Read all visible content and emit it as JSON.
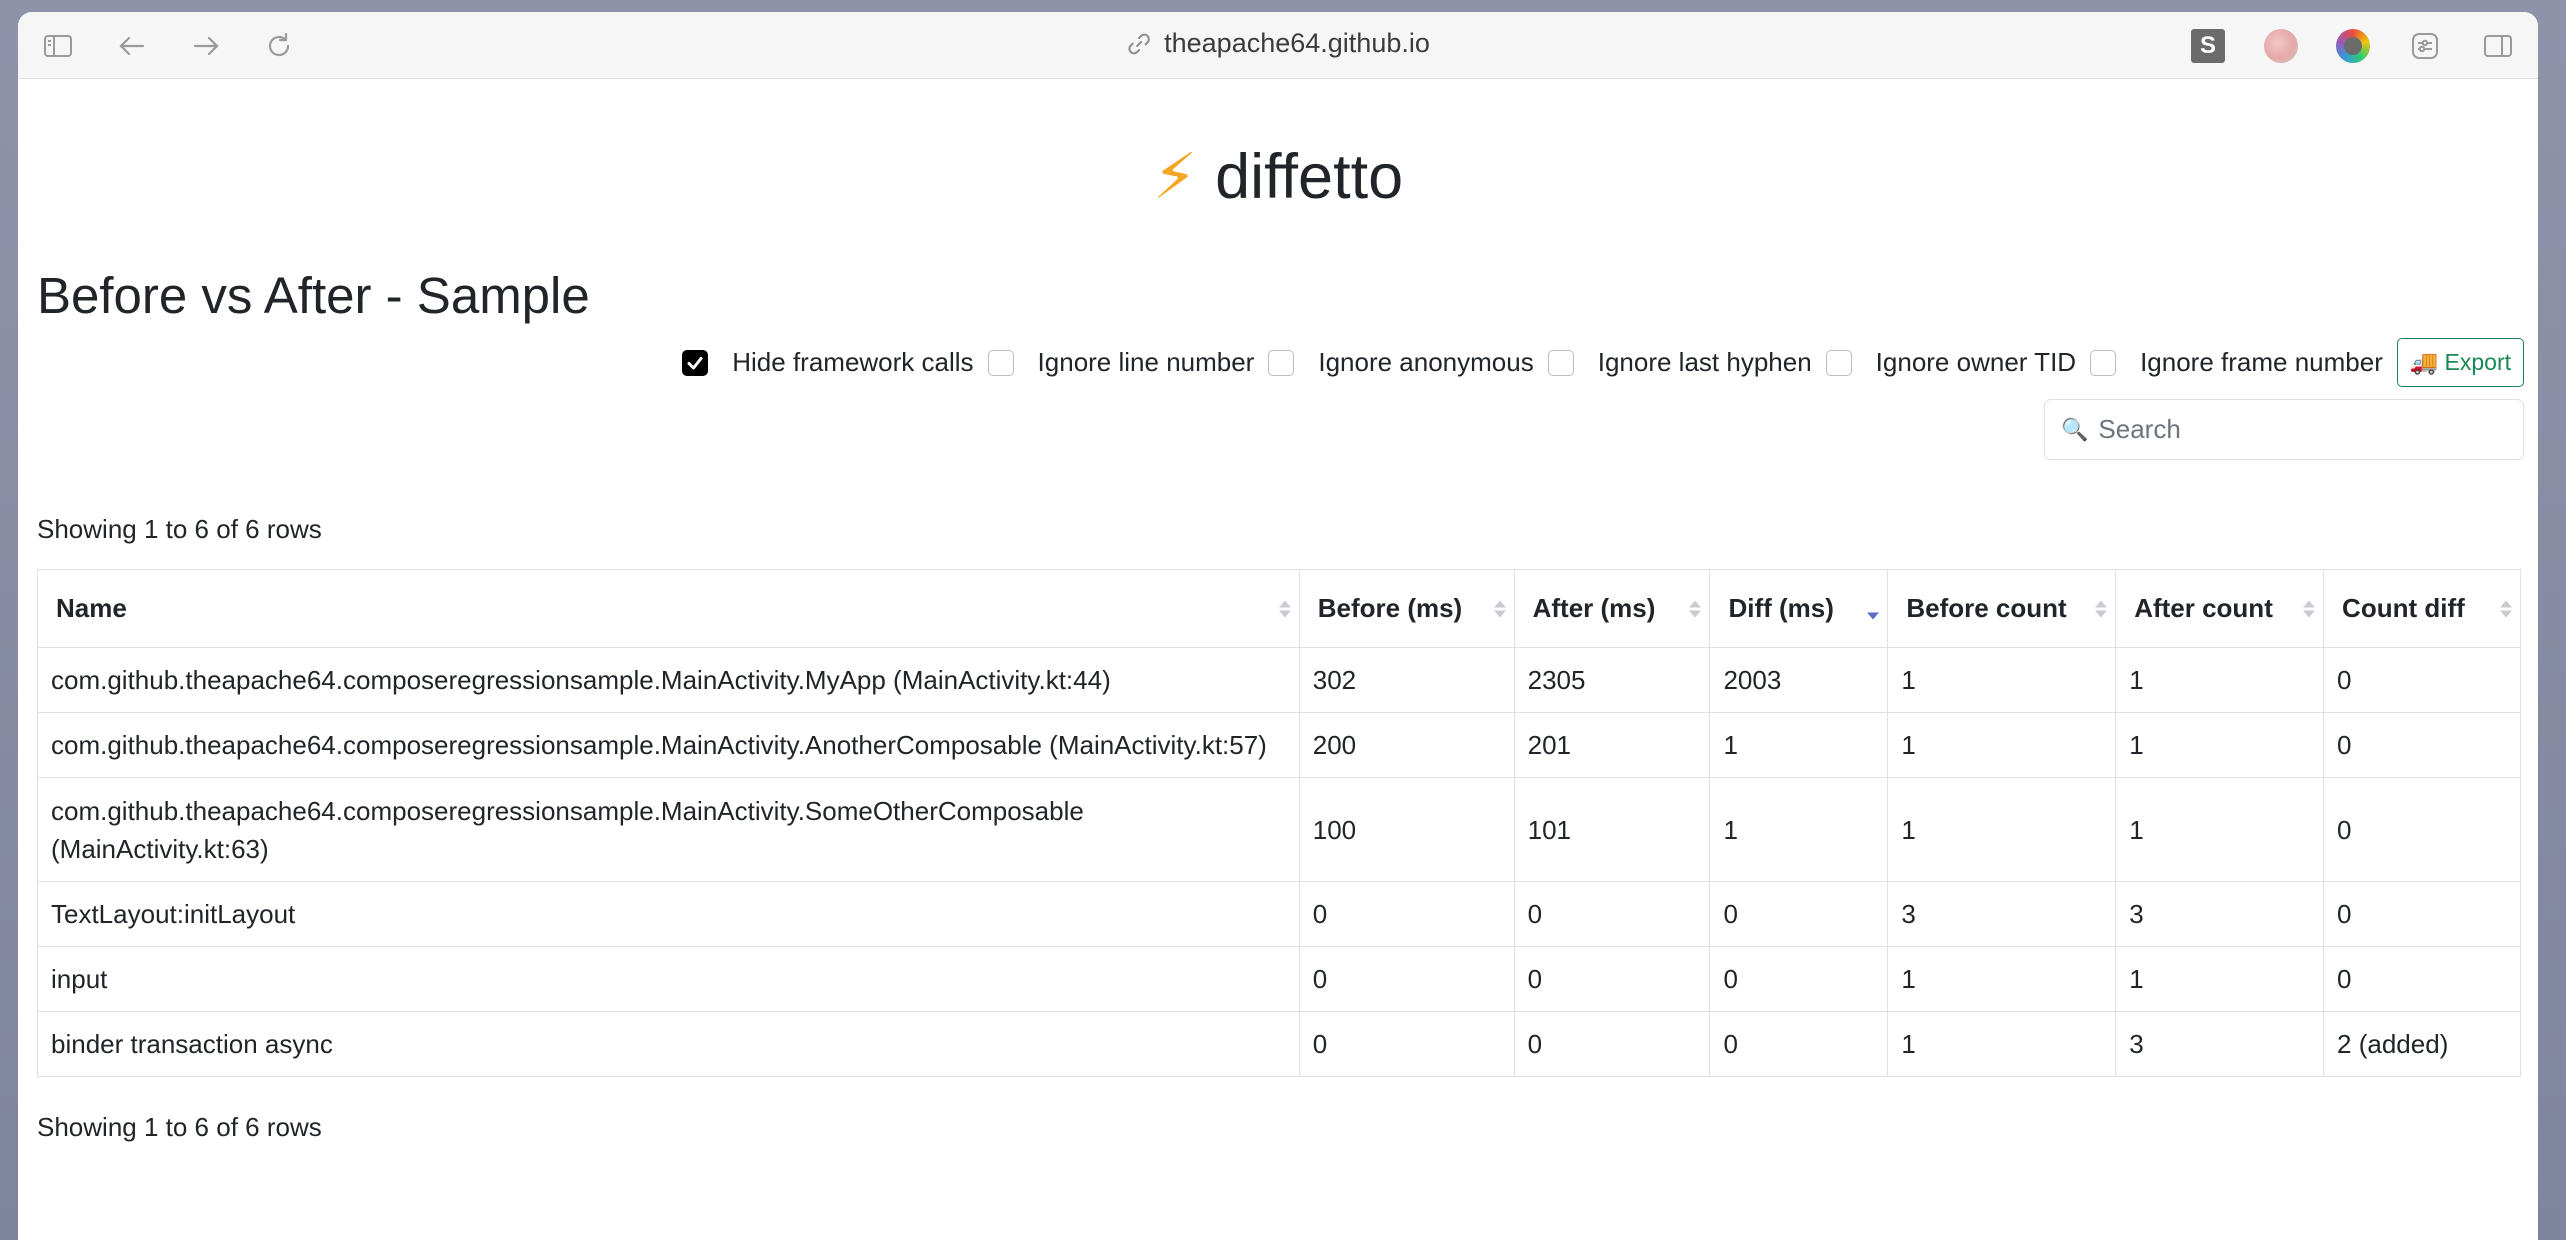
{
  "browser": {
    "url": "theapache64.github.io"
  },
  "brand": {
    "bolt": "⚡",
    "name": "diffetto"
  },
  "page_title": "Before vs After - Sample",
  "options": [
    {
      "label": "Hide framework calls",
      "checked": true
    },
    {
      "label": "Ignore line number",
      "checked": false
    },
    {
      "label": "Ignore anonymous",
      "checked": false
    },
    {
      "label": "Ignore last hyphen",
      "checked": false
    },
    {
      "label": "Ignore owner TID",
      "checked": false
    },
    {
      "label": "Ignore frame number",
      "checked": false
    }
  ],
  "export": {
    "emoji": "🚚",
    "label": "Export"
  },
  "search": {
    "placeholder": "Search"
  },
  "pagination": {
    "top": "Showing 1 to 6 of 6 rows",
    "bottom": "Showing 1 to 6 of 6 rows"
  },
  "table": {
    "columns": [
      "Name",
      "Before (ms)",
      "After (ms)",
      "Diff (ms)",
      "Before count",
      "After count",
      "Count diff"
    ],
    "sorted_column": "Diff (ms)",
    "sort_direction": "desc",
    "rows": [
      [
        "com.github.theapache64.composeregressionsample.MainActivity.MyApp (MainActivity.kt:44)",
        "302",
        "2305",
        "2003",
        "1",
        "1",
        "0"
      ],
      [
        "com.github.theapache64.composeregressionsample.MainActivity.AnotherComposable (MainActivity.kt:57)",
        "200",
        "201",
        "1",
        "1",
        "1",
        "0"
      ],
      [
        "com.github.theapache64.composeregressionsample.MainActivity.SomeOtherComposable (MainActivity.kt:63)",
        "100",
        "101",
        "1",
        "1",
        "1",
        "0"
      ],
      [
        "TextLayout:initLayout",
        "0",
        "0",
        "0",
        "3",
        "3",
        "0"
      ],
      [
        "input",
        "0",
        "0",
        "0",
        "1",
        "1",
        "0"
      ],
      [
        "binder transaction async",
        "0",
        "0",
        "0",
        "1",
        "3",
        "2 (added)"
      ]
    ]
  }
}
